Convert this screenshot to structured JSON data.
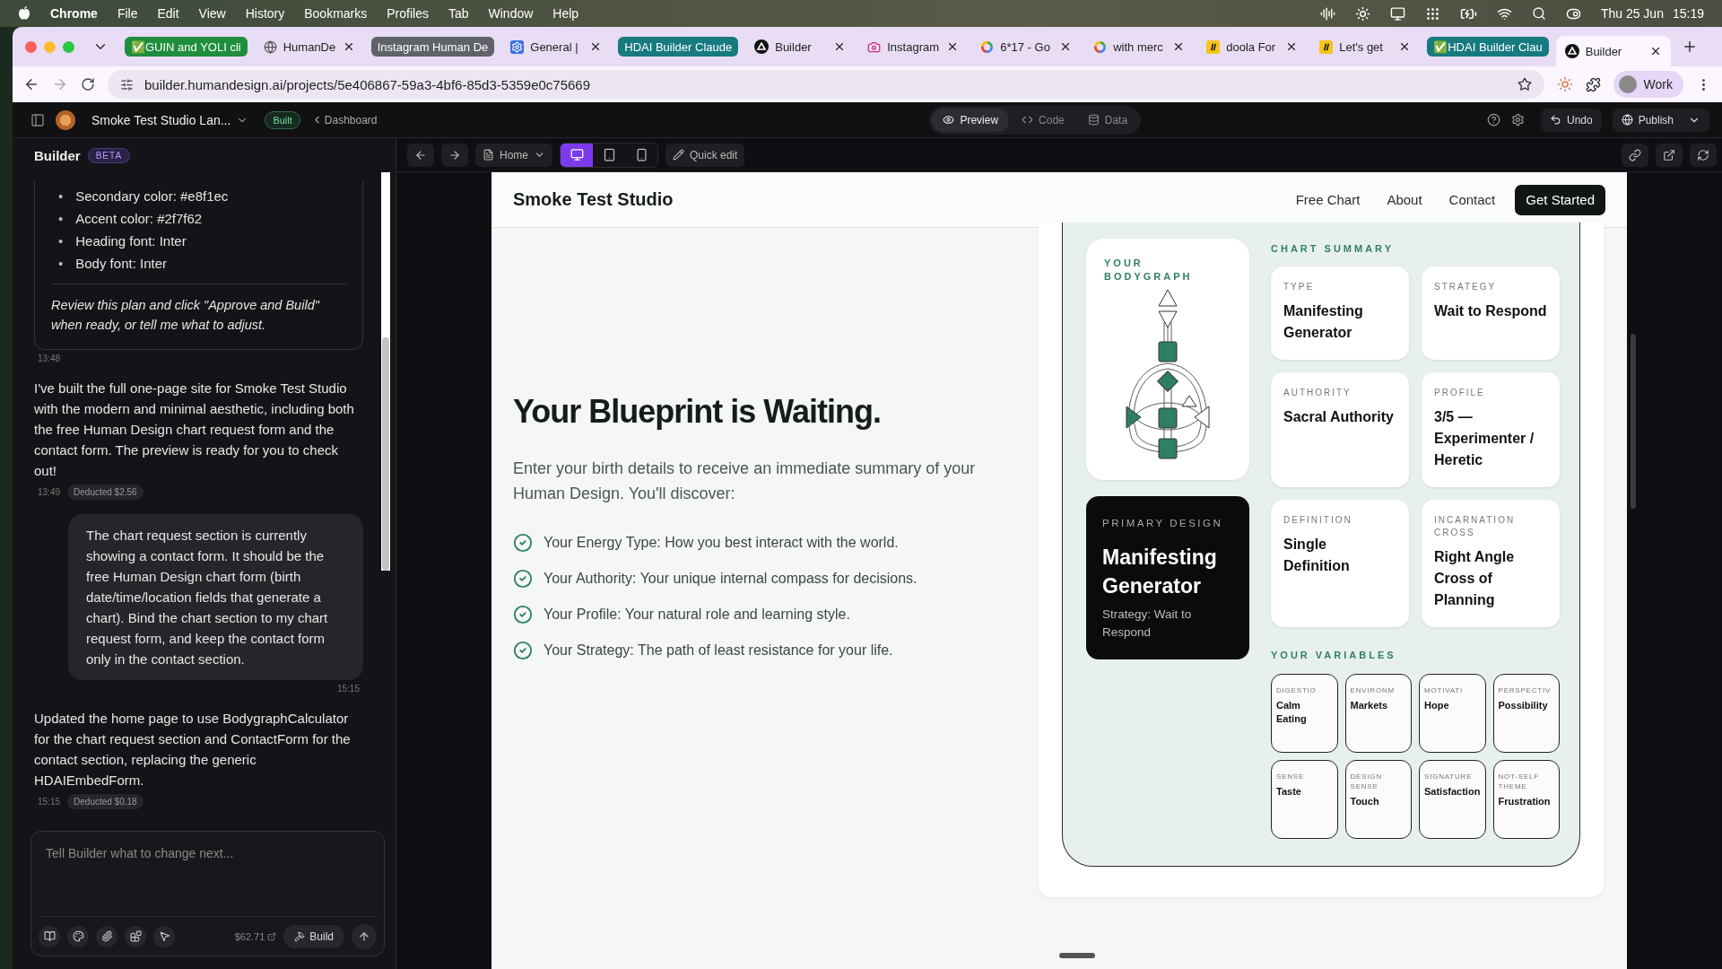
{
  "menu_bar": {
    "app": "Chrome",
    "items": [
      "File",
      "Edit",
      "View",
      "History",
      "Bookmarks",
      "Profiles",
      "Tab",
      "Window",
      "Help"
    ],
    "date": "Thu 25 Jun",
    "time": "15:19"
  },
  "tabs": [
    {
      "kind": "group",
      "label": "✅GUIN and YOLI cli",
      "color": "#1e8e3e",
      "selected": false
    },
    {
      "kind": "globe",
      "label": "HumanDe",
      "selected": false
    },
    {
      "kind": "group",
      "label": "Instagram Human De",
      "color": "#5f6368",
      "selected": false
    },
    {
      "kind": "cog",
      "label": "General |",
      "selected": false
    },
    {
      "kind": "group",
      "label": "HDAI Builder Claude",
      "color": "#167a80",
      "selected": false
    },
    {
      "kind": "triangle",
      "label": "Builder",
      "selected": false
    },
    {
      "kind": "camera",
      "label": "Instagram",
      "selected": false
    },
    {
      "kind": "ring",
      "label": "6*17 - Go",
      "selected": false
    },
    {
      "kind": "ring",
      "label": "with merc",
      "selected": false
    },
    {
      "kind": "slash",
      "label": "doola For",
      "selected": false
    },
    {
      "kind": "slash",
      "label": "Let's get",
      "selected": false
    },
    {
      "kind": "group",
      "label": "✅HDAI Builder Clau",
      "color": "#167a80",
      "selected": false
    },
    {
      "kind": "triangle",
      "label": "Builder",
      "selected": true
    }
  ],
  "address_bar": {
    "url": "builder.humandesign.ai/projects/5e406867-59a3-4bf6-85d3-5359e0c75669",
    "profile": "Work"
  },
  "app_header": {
    "project": "Smoke Test Studio Lan...",
    "status": "Built",
    "back": "Dashboard",
    "views": [
      {
        "label": "Preview",
        "selected": true
      },
      {
        "label": "Code",
        "selected": false
      },
      {
        "label": "Data",
        "selected": false
      }
    ],
    "undo": "Undo",
    "publish": "Publish"
  },
  "builder": {
    "title": "Builder",
    "badge": "BETA",
    "messages": [
      {
        "kind": "plan",
        "marker": "•",
        "bullets": [
          "Secondary color: #e8f1ec",
          "Accent color: #2f7f62",
          "Heading font: Inter",
          "Body font: Inter"
        ],
        "note": "Review this plan and click \"Approve and Build\" when ready, or tell me what to adjust.",
        "time": "13:48"
      },
      {
        "kind": "assistant",
        "text": "I've built the full one-page site for Smoke Test Studio with the modern and minimal aesthetic, including both the free Human Design chart request form and the contact form. The preview is ready for you to check out!",
        "time": "13:49",
        "cost": "Deducted $2.56"
      },
      {
        "kind": "user",
        "text": "The chart request section is currently showing a contact form. It should be the free Human Design chart form (birth date/time/location fields that generate a chart). Bind the chart section to my chart request form, and keep the contact form only in the contact section.",
        "time": "15:15"
      },
      {
        "kind": "assistant",
        "text": "Updated the home page to use BodygraphCalculator for the chart request section and ContactForm for the contact section, replacing the generic HDAIEmbedForm.",
        "time": "15:15",
        "cost": "Deducted $0.18"
      }
    ],
    "composer": {
      "placeholder": "Tell Builder what to change next...",
      "credits": "$62.71",
      "build": "Build"
    }
  },
  "preview_toolbar": {
    "page": "Home",
    "devices": [
      {
        "kind": "desktop",
        "selected": true
      },
      {
        "kind": "tablet",
        "selected": false
      },
      {
        "kind": "phone",
        "selected": false
      }
    ],
    "quick_edit": "Quick edit"
  },
  "site": {
    "brand": "Smoke Test Studio",
    "nav": [
      "Free Chart",
      "About",
      "Contact"
    ],
    "cta": "Get Started",
    "hero": {
      "title": "Your Blueprint is Waiting.",
      "intro": "Enter your birth details to receive an immediate summary of your Human Design. You'll discover:",
      "points": [
        "Your Energy Type: How you best interact with the world.",
        "Your Authority: Your unique internal compass for decisions.",
        "Your Profile: Your natural role and learning style.",
        "Your Strategy: The path of least resistance for your life."
      ]
    },
    "chart": {
      "bodygraph_label": "YOUR BODYGRAPH",
      "primary": {
        "label": "PRIMARY DESIGN",
        "title": "Manifesting Generator",
        "subtitle": "Strategy: Wait to Respond"
      },
      "summary_title": "CHART SUMMARY",
      "summary": [
        {
          "label": "TYPE",
          "value": "Manifesting Generator"
        },
        {
          "label": "STRATEGY",
          "value": "Wait to Respond"
        },
        {
          "label": "AUTHORITY",
          "value": "Sacral Authority"
        },
        {
          "label": "PROFILE",
          "value": "3/5 — Experimenter / Heretic"
        },
        {
          "label": "DEFINITION",
          "value": "Single Definition"
        },
        {
          "label": "INCARNATION CROSS",
          "value": "Right Angle Cross of Planning"
        }
      ],
      "variables_title": "YOUR VARIABLES",
      "variables": [
        {
          "label": "DIGESTIO",
          "value": "Calm Eating"
        },
        {
          "label": "ENVIRONM",
          "value": "Markets"
        },
        {
          "label": "MOTIVATI",
          "value": "Hope"
        },
        {
          "label": "PERSPECTIV",
          "value": "Possibility"
        },
        {
          "label": "SENSE",
          "value": "Taste"
        },
        {
          "label": "DESIGN SENSE",
          "value": "Touch"
        },
        {
          "label": "SIGNATURE",
          "value": "Satisfaction"
        },
        {
          "label": "NOT-SELF THEME",
          "value": "Frustration"
        }
      ]
    }
  }
}
